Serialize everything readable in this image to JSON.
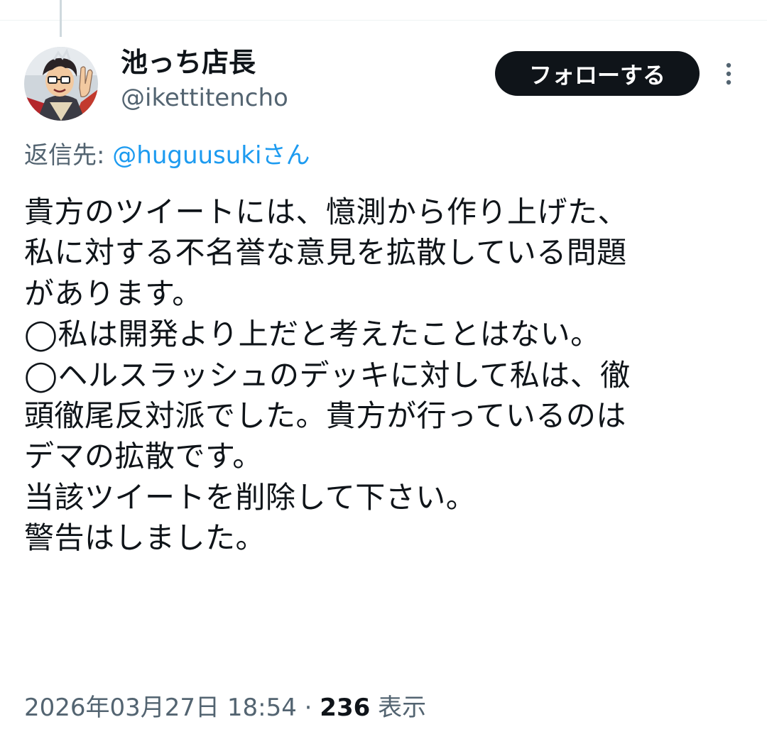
{
  "author": {
    "display_name": "池っち店長",
    "handle": "@ikettitencho"
  },
  "follow_button_label": "フォローする",
  "more_icon": "more-vertical-icon",
  "reply": {
    "prefix": "返信先: ",
    "mention": "@huguusukiさん"
  },
  "tweet_lines": [
    "貴方のツイートには、憶測から作り上げた、",
    "私に対する不名誉な意見を拡散している問題",
    "があります。",
    "◯私は開発より上だと考えたことはない。",
    "◯ヘルスラッシュのデッキに対して私は、徹",
    "頭徹尾反対派でした。貴方が行っているのは",
    "デマの拡散です。",
    "当該ツイートを削除して下さい。",
    "警告はしました。"
  ],
  "meta": {
    "timestamp": "2026年03月27日 18:54",
    "separator": " · ",
    "views_count": "236",
    "views_label": " 表示"
  },
  "colors": {
    "text_primary": "#0f1419",
    "text_secondary": "#536471",
    "link": "#1d9bf0",
    "button_bg": "#0f1419",
    "button_text": "#ffffff"
  }
}
